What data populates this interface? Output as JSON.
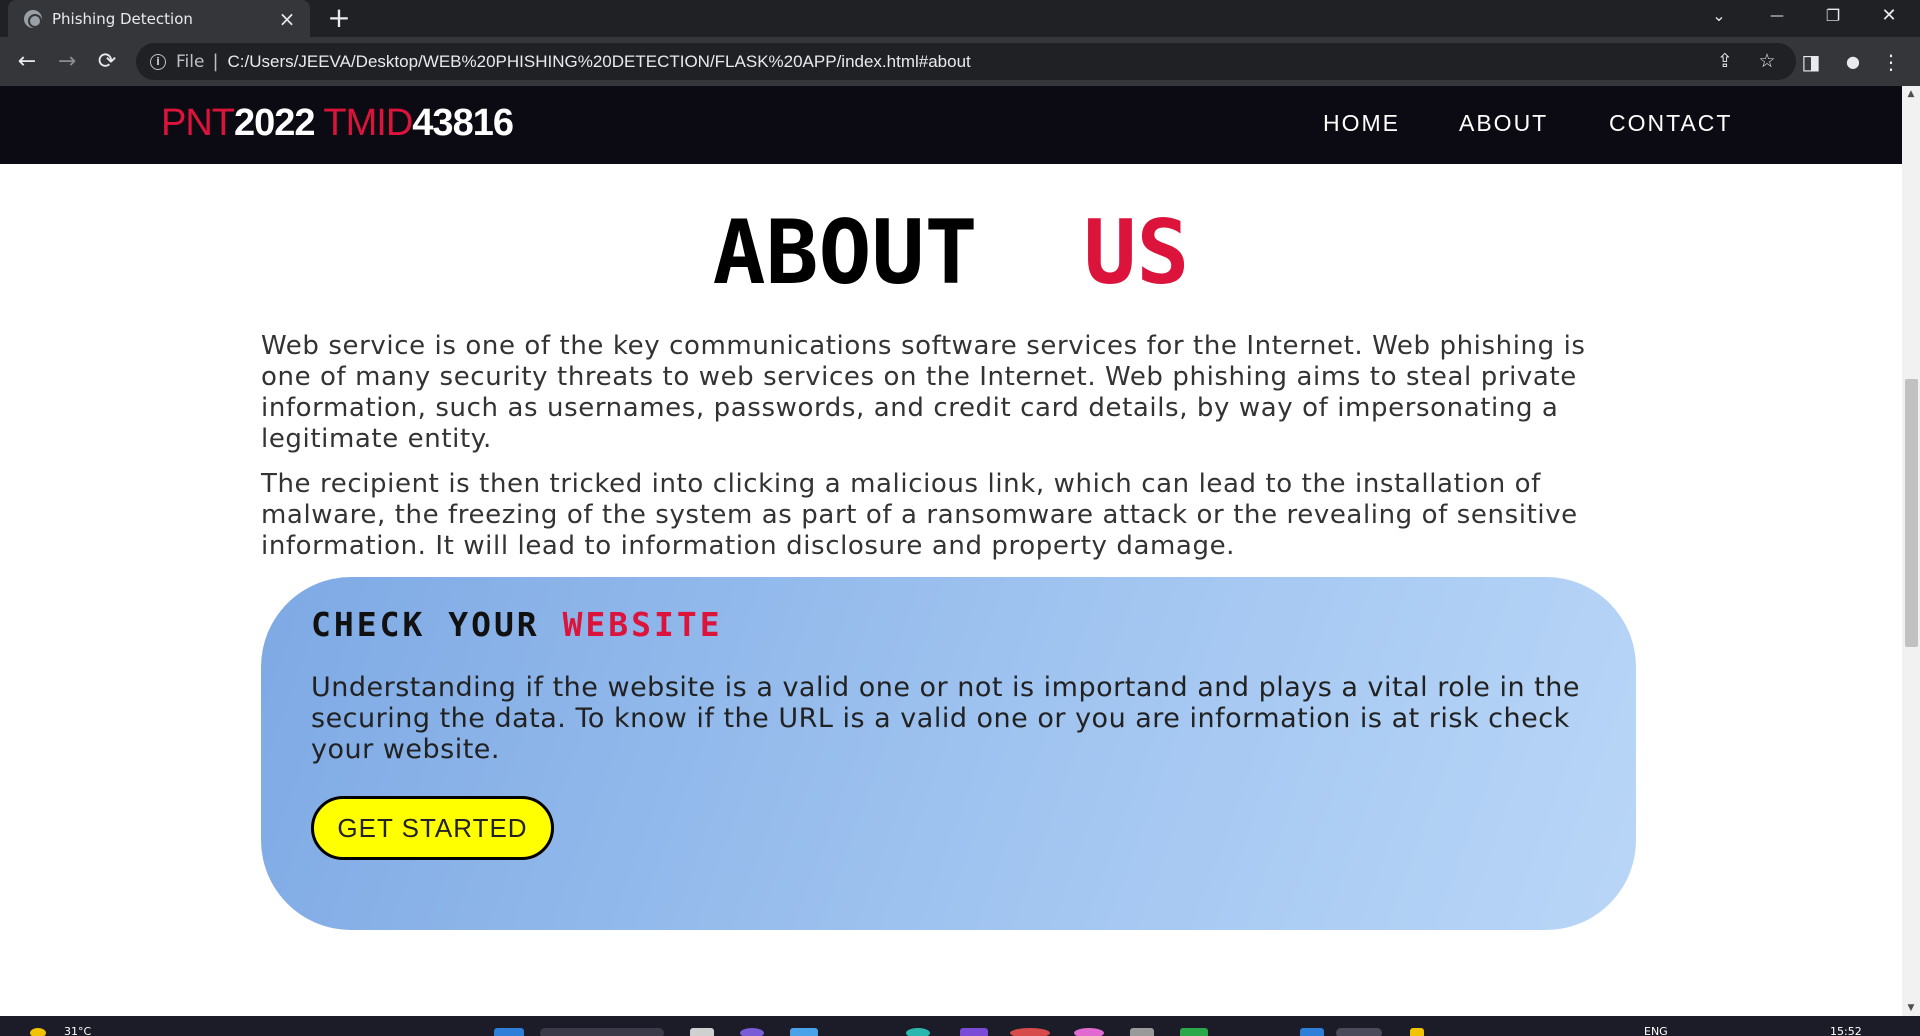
{
  "browser": {
    "tab_title": "Phishing Detection",
    "tab_close": "×",
    "new_tab": "+",
    "url_scheme_label": "File",
    "url_separator": "|",
    "url": "C:/Users/JEEVA/Desktop/WEB%20PHISHING%20DETECTION/FLASK%20APP/index.html#about",
    "back_icon": "←",
    "forward_icon": "→",
    "reload_icon": "⟳",
    "info_icon": "i",
    "share_icon": "⇪",
    "bookmark_icon": "☆",
    "sidepanel_icon": "◨",
    "profile_icon": "●",
    "menu_icon": "⋮",
    "tabsearch_icon": "⌄",
    "minimize_icon": "—",
    "restore_icon": "❐",
    "close_icon": "✕"
  },
  "site": {
    "logo": {
      "part1": "PNT",
      "part2": "2022",
      "part3": " TMID",
      "part4": "43816"
    },
    "nav": {
      "home": "HOME",
      "about": "ABOUT",
      "contact": "CONTACT"
    }
  },
  "about": {
    "heading_main": "ABOUT",
    "heading_accent": "US",
    "paragraph1": "Web service is one of the key communications software services for the Internet. Web phishing is one of many security threats to web services on the Internet. Web phishing aims to steal private information, such as usernames, passwords, and credit card details, by way of impersonating a legitimate entity.",
    "paragraph2": "The recipient is then tricked into clicking a malicious link, which can lead to the installation of malware, the freezing of the system as part of a ransomware attack or the revealing of sensitive information. It will lead to information disclosure and property damage."
  },
  "check_card": {
    "title_main": "CHECK YOUR",
    "title_accent": "WEBSITE",
    "text": "Understanding if the website is a valid one or not is importand and plays a vital role in the securing the data. To know if the URL is a valid one or you are information is at risk check your website.",
    "button_label": "GET STARTED"
  },
  "scrollbar": {
    "up_icon": "▲",
    "down_icon": "▼"
  },
  "taskbar": {
    "weather": "31°C",
    "lang": "ENG",
    "time": "15:52"
  },
  "colors": {
    "accent_red": "#dc143c",
    "nav_bg": "#0c0b13",
    "button_yellow": "#ffff00",
    "card_gradient_start": "#7ea9e4",
    "card_gradient_end": "#b9d6f7"
  }
}
